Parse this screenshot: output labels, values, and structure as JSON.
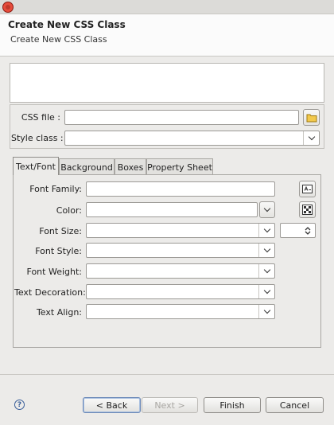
{
  "header": {
    "title": "Create New CSS Class",
    "description": "Create New CSS Class"
  },
  "fields": {
    "css_file_label": "CSS file :",
    "css_file_value": "",
    "style_class_label": "Style class :",
    "style_class_value": ""
  },
  "tabs": [
    {
      "label": "Text/Font",
      "active": true
    },
    {
      "label": "Background",
      "active": false
    },
    {
      "label": "Boxes",
      "active": false
    },
    {
      "label": "Property Sheet",
      "active": false
    }
  ],
  "text_font": {
    "font_family_label": "Font Family:",
    "color_label": "Color:",
    "font_size_label": "Font Size:",
    "font_style_label": "Font Style:",
    "font_weight_label": "Font Weight:",
    "text_decoration_label": "Text Decoration:",
    "text_align_label": "Text Align:"
  },
  "buttons": {
    "help": "?",
    "back": "< Back",
    "next": "Next >",
    "finish": "Finish",
    "cancel": "Cancel"
  },
  "icons": {
    "app": "app-icon",
    "folder": "folder-icon",
    "font_picker": "font-picker-icon",
    "color_picker": "color-picker-icon",
    "help": "help-icon"
  }
}
